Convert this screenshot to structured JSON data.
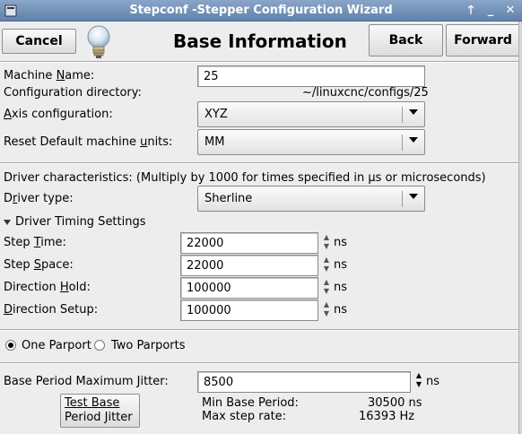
{
  "window": {
    "title": "Stepconf -Stepper Configuration Wizard",
    "controls": [
      "🡑",
      "_",
      "✕"
    ]
  },
  "header": {
    "cancel_label": "Cancel",
    "title": "Base Information",
    "back_label": "Back",
    "forward_label": "Forward"
  },
  "machine": {
    "name_pre": "Machine ",
    "name_u": "N",
    "name_post": "ame:",
    "name_value": "25",
    "config_dir_label": "Configuration directory:",
    "config_dir_value": "~/linuxcnc/configs/25",
    "axis_u": "A",
    "axis_post": "xis configuration:",
    "axis_value": "XYZ",
    "units_pre": "Reset Default machine ",
    "units_u": "u",
    "units_post": "nits:",
    "units_value": "MM"
  },
  "driver": {
    "characteristics_label": "Driver characteristics: (Multiply by 1000 for times specified in µs or microseconds)",
    "type_pre": "D",
    "type_u": "r",
    "type_post": "iver type:",
    "type_value": "Sherline",
    "timing_expander": "Driver Timing Settings",
    "rows": [
      {
        "pre": "Step ",
        "u": "T",
        "post": "ime:",
        "value": "22000",
        "unit": "ns"
      },
      {
        "pre": "Step ",
        "u": "S",
        "post": "pace:",
        "value": "22000",
        "unit": "ns"
      },
      {
        "pre": "Direction ",
        "u": "H",
        "post": "old:",
        "value": "100000",
        "unit": "ns"
      },
      {
        "pre": "",
        "u": "D",
        "post": "irection Setup:",
        "value": "100000",
        "unit": "ns"
      }
    ]
  },
  "parport": {
    "one_label": "One Parport",
    "two_label": "Two Parports",
    "selected": "one"
  },
  "jitter": {
    "label": "Base Period Maximum Jitter:",
    "value": "8500",
    "unit": "ns",
    "test_button_line1": "Test Base",
    "test_button_line2": "Period Jitter",
    "min_base_period_label": "Min Base Period:",
    "min_base_period_value": "30500 ns",
    "max_step_rate_label": "Max step rate:",
    "max_step_rate_value": "16393 Hz"
  }
}
